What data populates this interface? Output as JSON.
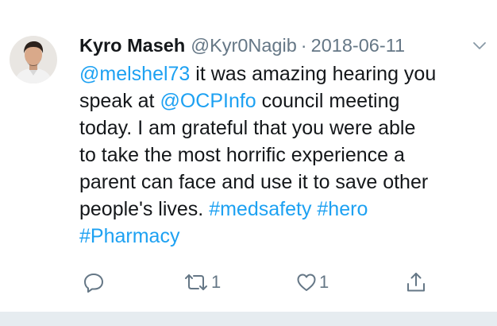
{
  "tweet": {
    "author_name": "Kyro Maseh",
    "author_handle": "@Kyr0Nagib",
    "separator": "·",
    "date": "2018-06-11",
    "lines": [
      [
        {
          "text": "@melshel73",
          "link": true
        },
        {
          "text": " it was amazing hearing you",
          "link": false
        }
      ],
      [
        {
          "text": "speak at ",
          "link": false
        },
        {
          "text": "@OCPInfo",
          "link": true
        },
        {
          "text": " council meeting",
          "link": false
        }
      ],
      [
        {
          "text": "today. I am grateful that you were able",
          "link": false
        }
      ],
      [
        {
          "text": "to take the most horrific experience a",
          "link": false
        }
      ],
      [
        {
          "text": "parent can face and use it to save other",
          "link": false
        }
      ],
      [
        {
          "text": "people's lives. ",
          "link": false
        },
        {
          "text": "#medsafety",
          "link": true
        },
        {
          "text": " ",
          "link": false
        },
        {
          "text": "#hero",
          "link": true
        }
      ],
      [
        {
          "text": "#Pharmacy",
          "link": true
        }
      ]
    ]
  },
  "actions": {
    "reply_icon": "reply-icon",
    "retweet_icon": "retweet-icon",
    "retweet_count": "1",
    "like_icon": "heart-icon",
    "like_count": "1",
    "share_icon": "share-icon"
  },
  "colors": {
    "link": "#1da1f2",
    "secondary_text": "#657786",
    "primary_text": "#14171a",
    "divider": "#e6ecf0"
  }
}
